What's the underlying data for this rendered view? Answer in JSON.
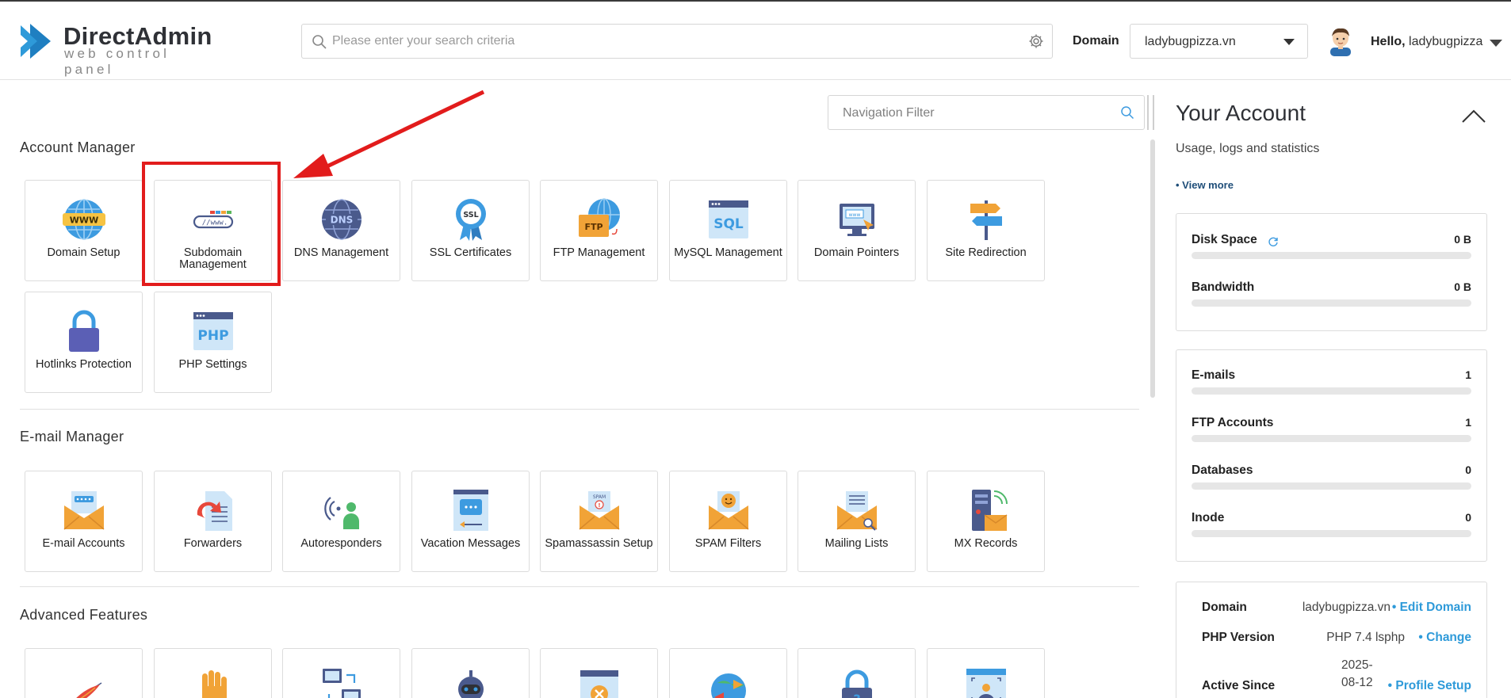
{
  "brand": {
    "name": "DirectAdmin",
    "tagline": "web control panel"
  },
  "search": {
    "placeholder": "Please enter your search criteria"
  },
  "domain_picker": {
    "label": "Domain",
    "value": "ladybugpizza.vn"
  },
  "user": {
    "greeting": "Hello,",
    "name": "ladybugpizza"
  },
  "nav_filter": {
    "placeholder": "Navigation Filter"
  },
  "sections": {
    "account": {
      "title": "Account Manager",
      "tiles": [
        {
          "label": "Domain Setup",
          "icon": "globe-www-icon"
        },
        {
          "label": "Subdomain Management",
          "icon": "subdomain-url-icon"
        },
        {
          "label": "DNS Management",
          "icon": "dns-globe-icon"
        },
        {
          "label": "SSL Certificates",
          "icon": "ssl-badge-icon"
        },
        {
          "label": "FTP Management",
          "icon": "ftp-folder-icon"
        },
        {
          "label": "MySQL Management",
          "icon": "sql-window-icon"
        },
        {
          "label": "Domain Pointers",
          "icon": "domain-pointer-monitor-icon"
        },
        {
          "label": "Site Redirection",
          "icon": "signpost-icon"
        },
        {
          "label": "Hotlinks Protection",
          "icon": "padlock-icon"
        },
        {
          "label": "PHP Settings",
          "icon": "php-window-icon"
        }
      ]
    },
    "email": {
      "title": "E-mail Manager",
      "tiles": [
        {
          "label": "E-mail Accounts",
          "icon": "envelope-password-icon"
        },
        {
          "label": "Forwarders",
          "icon": "forward-arrow-icon"
        },
        {
          "label": "Autoresponders",
          "icon": "autoresponder-person-icon"
        },
        {
          "label": "Vacation Messages",
          "icon": "vacation-message-icon"
        },
        {
          "label": "Spamassassin Setup",
          "icon": "spam-envelope-icon"
        },
        {
          "label": "SPAM Filters",
          "icon": "smile-envelope-icon"
        },
        {
          "label": "Mailing Lists",
          "icon": "mailing-list-envelope-icon"
        },
        {
          "label": "MX Records",
          "icon": "mx-server-icon"
        }
      ]
    },
    "advanced": {
      "title": "Advanced Features",
      "tiles": [
        {
          "label": "",
          "icon": "feather-icon"
        },
        {
          "label": "",
          "icon": "hand-icon"
        },
        {
          "label": "",
          "icon": "network-computers-icon"
        },
        {
          "label": "",
          "icon": "robot-icon"
        },
        {
          "label": "",
          "icon": "blocked-window-icon"
        },
        {
          "label": "",
          "icon": "globe-arrows-icon"
        },
        {
          "label": "",
          "icon": "lock-question-icon"
        },
        {
          "label": "",
          "icon": "user-window-icon"
        }
      ]
    }
  },
  "account_panel": {
    "title": "Your Account",
    "subtitle": "Usage, logs and statistics",
    "view_more": "• View more",
    "usage": [
      {
        "name": "Disk Space",
        "value": "0 B",
        "fill": 0
      },
      {
        "name": "Bandwidth",
        "value": "0 B",
        "fill": 0
      }
    ],
    "counts": [
      {
        "name": "E-mails",
        "value": "1",
        "fill": 0
      },
      {
        "name": "FTP Accounts",
        "value": "1",
        "fill": 0
      },
      {
        "name": "Databases",
        "value": "0",
        "fill": 0
      },
      {
        "name": "Inode",
        "value": "0",
        "fill": 0
      }
    ],
    "info": [
      {
        "key": "Domain",
        "value": "ladybugpizza.vn",
        "action": "• Edit Domain"
      },
      {
        "key": "PHP Version",
        "value": "PHP 7.4 lsphp",
        "action": "• Change"
      },
      {
        "key": "Active Since",
        "value_line1": "2025-",
        "value_line2": "08-12",
        "action": "• Profile Setup"
      }
    ]
  },
  "colors": {
    "accent": "#2e9ad9",
    "highlight": "#e21c1c",
    "logo": "#2e9ad9"
  }
}
